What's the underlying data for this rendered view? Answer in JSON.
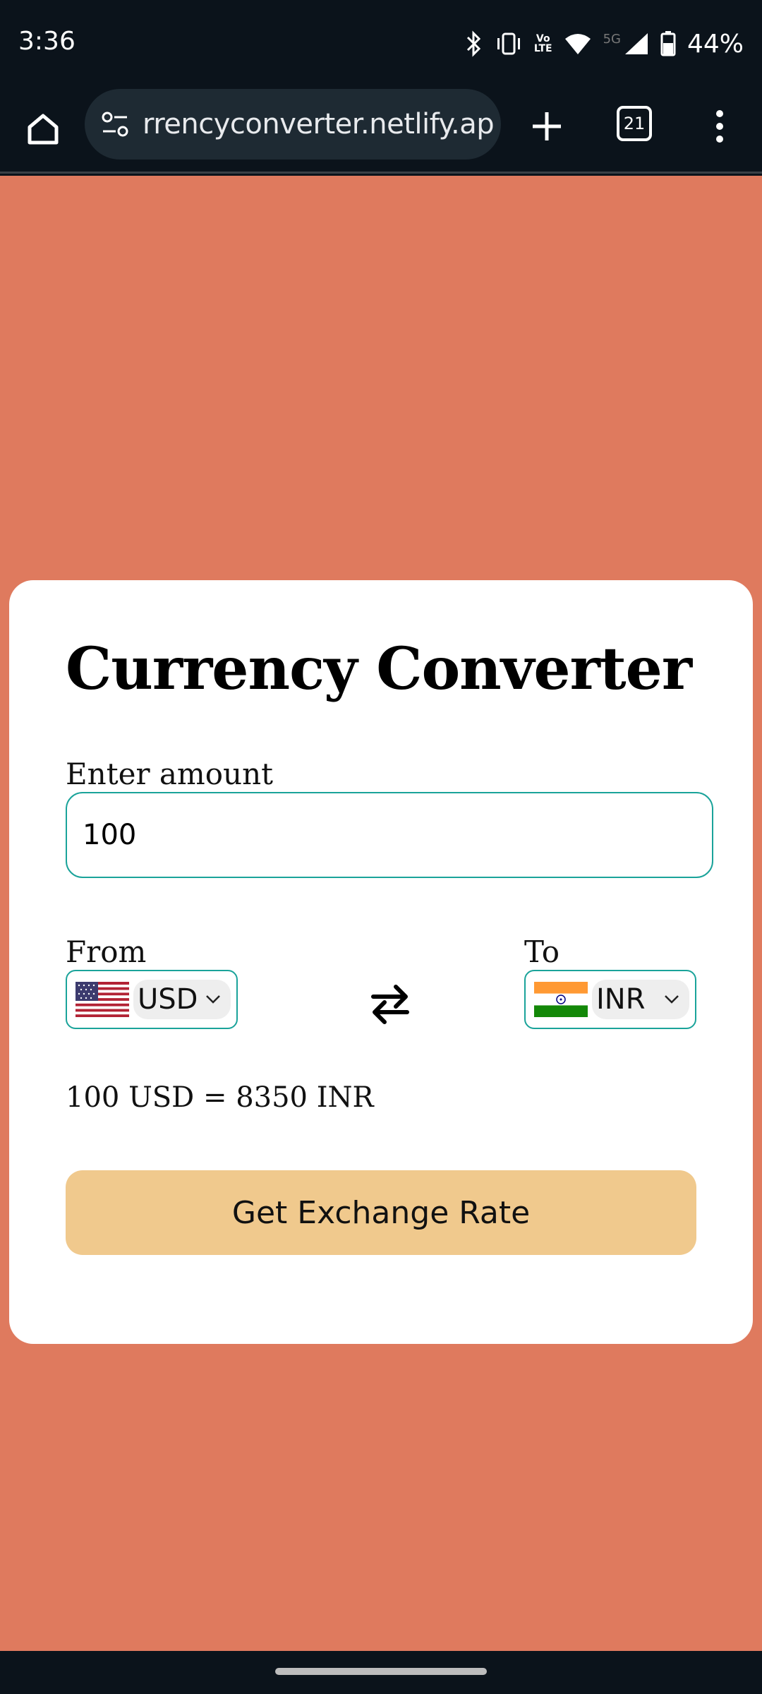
{
  "status_bar": {
    "time": "3:36",
    "network_lte": "LTE",
    "network_volte": "Vo",
    "network_5g": "5G",
    "battery": "44%"
  },
  "browser": {
    "url": "rrencyconverter.netlify.app",
    "tab_count": "21",
    "icons": [
      "home-icon",
      "tune-icon",
      "plus-icon",
      "tabs-icon",
      "more-vert-icon"
    ]
  },
  "converter": {
    "title": "Currency Converter",
    "amount_label": "Enter amount",
    "amount_value": "100",
    "from_label": "From",
    "to_label": "To",
    "from_currency": "USD",
    "to_currency": "INR",
    "result_text": "100 USD = 8350 INR",
    "button_label": "Get Exchange Rate"
  },
  "colors": {
    "page_background": "#df7a5e",
    "accent_border": "#1aa39a",
    "button_background": "#f0c98d",
    "system_bar": "#0b131b"
  }
}
